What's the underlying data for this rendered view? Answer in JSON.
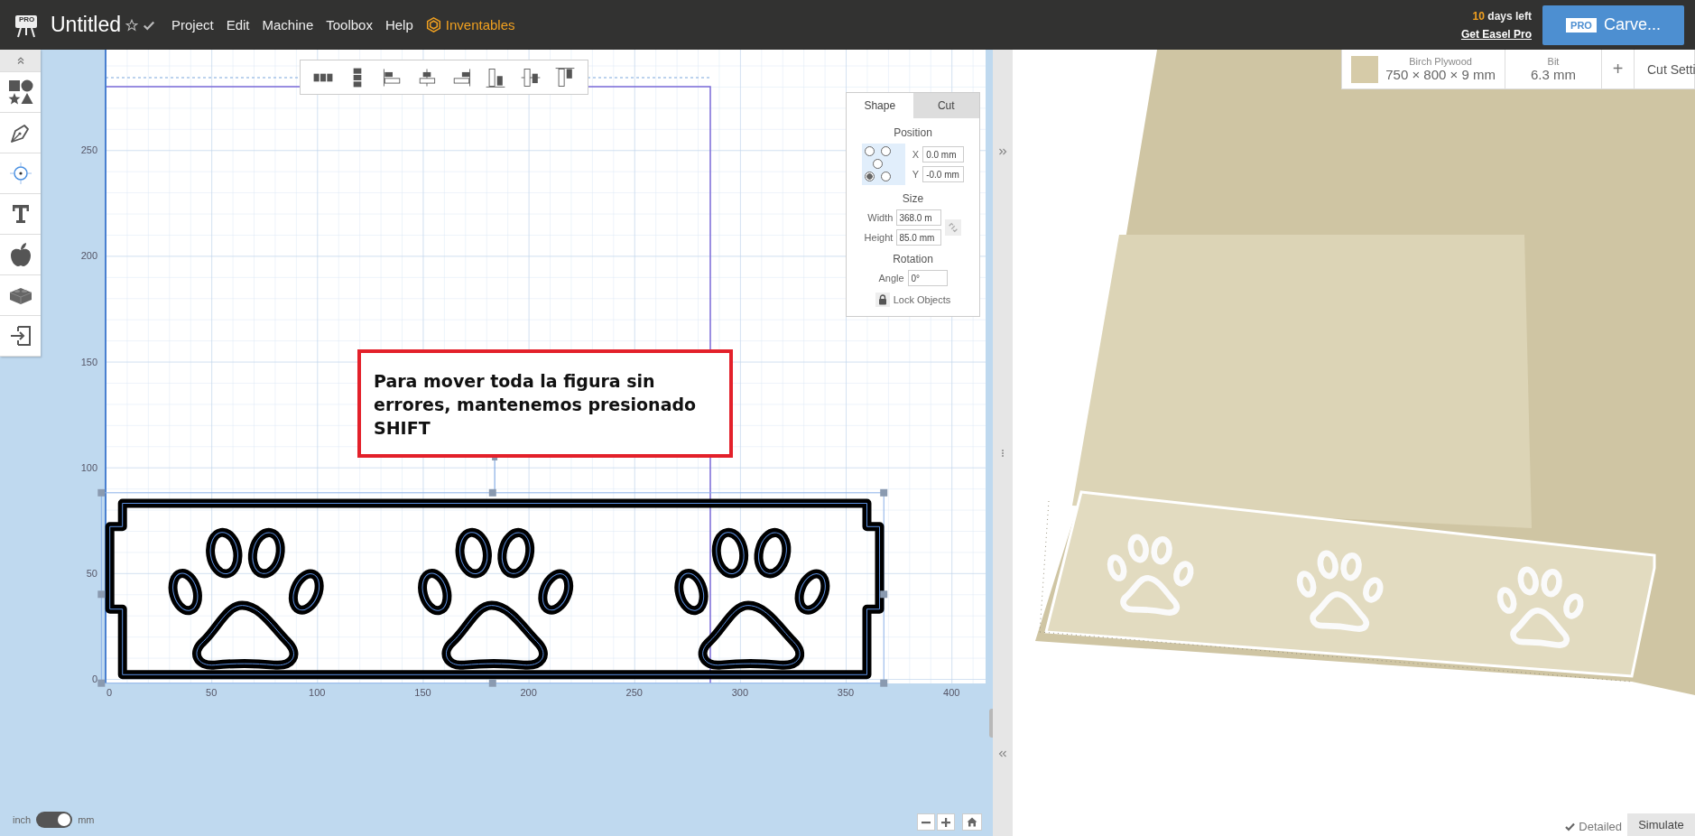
{
  "app_bar": {
    "logo_badge": "PRO",
    "title": "Untitled",
    "menu": [
      "Project",
      "Edit",
      "Machine",
      "Toolbox",
      "Help"
    ],
    "brand_link": "Inventables",
    "trial_count": "10",
    "trial_text": "days left",
    "upgrade_link": "Get Easel Pro",
    "carve_badge": "PRO",
    "carve_label": "Carve..."
  },
  "material_bar": {
    "material_name": "Birch Plywood",
    "material_size": "750 × 800 × 9 mm",
    "bit_label": "Bit",
    "bit_value": "6.3 mm",
    "add_label": "+",
    "cut_settings": "Cut Setti"
  },
  "rulers": {
    "y_labels": [
      "250",
      "200",
      "150",
      "100",
      "50",
      "0"
    ],
    "x_labels": [
      "0",
      "50",
      "100",
      "150",
      "200",
      "250",
      "300",
      "350",
      "400"
    ]
  },
  "annotation": "Para mover toda la figura sin errores, mantenemos presionado SHIFT",
  "inspector": {
    "tabs": [
      {
        "label": "Shape",
        "selected": true
      },
      {
        "label": "Cut",
        "selected": false
      }
    ],
    "position_heading": "Position",
    "anchors": [
      {
        "selected": false
      },
      {
        "selected": false
      },
      {
        "selected": false
      },
      {
        "selected": true
      },
      {
        "selected": false
      }
    ],
    "x_label": "X",
    "x_value": "0.0 mm",
    "y_label": "Y",
    "y_value": "-0.0 mm",
    "size_heading": "Size",
    "width_label": "Width",
    "width_value": "368.0 m",
    "height_label": "Height",
    "height_value": "85.0 mm",
    "rotation_heading": "Rotation",
    "angle_label": "Angle",
    "angle_value": "0°",
    "lock_label": "Lock Objects"
  },
  "units_toggle": {
    "left_label": "inch",
    "right_label": "mm",
    "on": true
  },
  "view_mode": {
    "detailed_label": "Detailed",
    "detailed_checked": true,
    "simulate_label": "Simulate"
  }
}
